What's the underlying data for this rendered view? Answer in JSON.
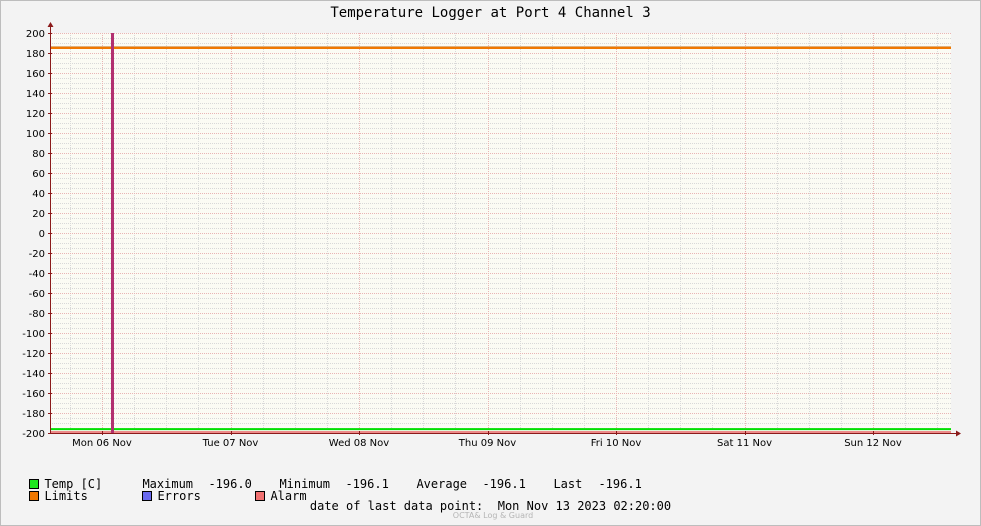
{
  "chart_data": {
    "type": "line",
    "title": "Temperature Logger at Port 4 Channel 3",
    "ylim": [
      -200,
      200
    ],
    "yticks": [
      200,
      180,
      160,
      140,
      120,
      100,
      80,
      60,
      40,
      20,
      0,
      -20,
      -40,
      -60,
      -80,
      -100,
      -120,
      -140,
      -160,
      -180,
      -200
    ],
    "xticks": [
      "Mon 06 Nov",
      "Tue 07 Nov",
      "Wed 08 Nov",
      "Thu 09 Nov",
      "Fri 10 Nov",
      "Sat 11 Nov",
      "Sun 12 Nov"
    ],
    "xlim_days": [
      0,
      7
    ],
    "grid": true,
    "series": [
      {
        "name": "Temp [C]",
        "color": "#00e000",
        "x_days": [
          0,
          7
        ],
        "values": [
          -196.1,
          -196.1
        ]
      },
      {
        "name": "Limits",
        "color": "#f07800",
        "x_days": [
          0,
          7
        ],
        "values": [
          185,
          185
        ]
      },
      {
        "name": "Errors",
        "color": "#6a6af0",
        "x_days": [],
        "values": []
      },
      {
        "name": "Alarm",
        "color": "#f07070",
        "x_days": [],
        "values": []
      }
    ],
    "alarm_lower_value": -200,
    "event_marker_day": 0.1
  },
  "legend": {
    "temp_label": "Temp [C]",
    "limits_label": "Limits",
    "errors_label": "Errors",
    "alarm_label": "Alarm",
    "temp_color": "#1ee61e",
    "limits_color": "#f07800",
    "errors_color": "#6a6af0",
    "alarm_color": "#f07070"
  },
  "stats": {
    "maximum_label": "Maximum",
    "maximum_value": "-196.0",
    "minimum_label": "Minimum",
    "minimum_value": "-196.1",
    "average_label": "Average",
    "average_value": "-196.1",
    "last_label": "Last",
    "last_value": "-196.1"
  },
  "footer": {
    "last_data_label": "date of last data point:",
    "last_data_value": "Mon Nov 13 2023 02:20:00",
    "watermark": "OCTA& Log & Guard"
  }
}
